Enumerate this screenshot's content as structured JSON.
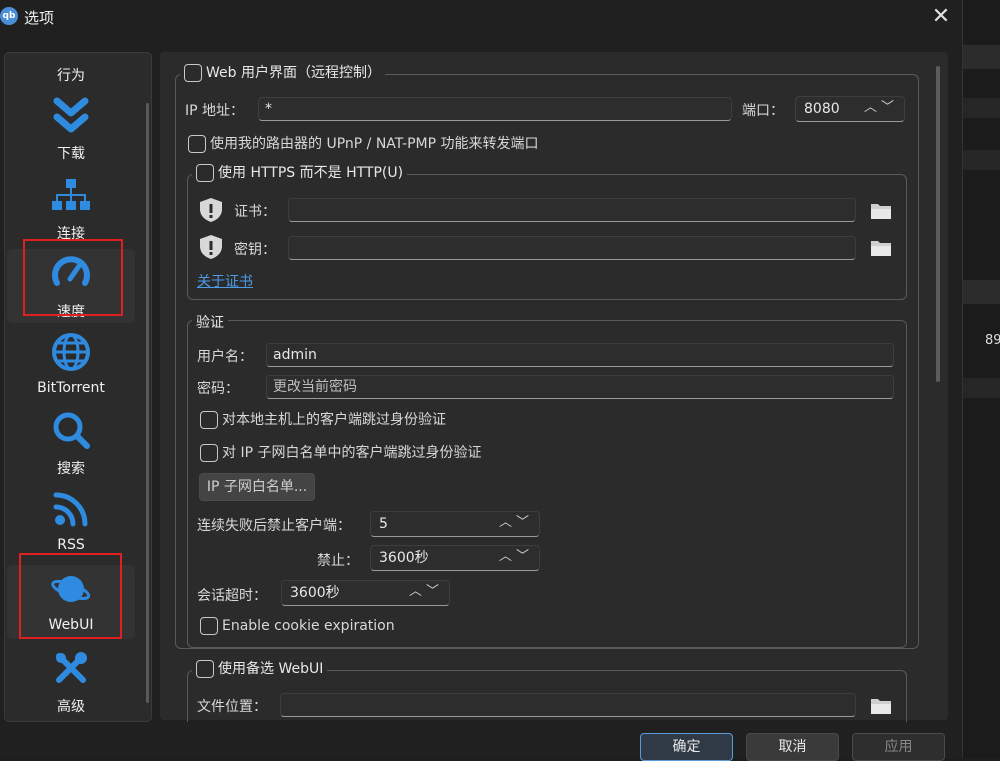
{
  "window": {
    "title": "选项",
    "app_icon_text": "qb"
  },
  "sidebar": {
    "items": [
      {
        "label": "行为",
        "icon": "behavior-icon"
      },
      {
        "label": "下载",
        "icon": "double-chevron-down-icon"
      },
      {
        "label": "连接",
        "icon": "network-icon"
      },
      {
        "label": "速度",
        "icon": "speedometer-icon"
      },
      {
        "label": "BitTorrent",
        "icon": "globe-icon"
      },
      {
        "label": "搜索",
        "icon": "search-icon"
      },
      {
        "label": "RSS",
        "icon": "rss-icon"
      },
      {
        "label": "WebUI",
        "icon": "planet-icon"
      },
      {
        "label": "高级",
        "icon": "tools-icon"
      }
    ],
    "selected": "WebUI"
  },
  "webui": {
    "group_label": "Web 用户界面（远程控制）",
    "ip_label": "IP 地址：",
    "ip_value": "*",
    "port_label": "端口：",
    "port_value": "8080",
    "upnp_label": "使用我的路由器的 UPnP / NAT-PMP 功能来转发端口",
    "https": {
      "group_label": "使用 HTTPS 而不是 HTTP(U)",
      "cert_label": "证书：",
      "cert_value": "",
      "key_label": "密钥：",
      "key_value": "",
      "about_link": "关于证书"
    },
    "auth": {
      "group_label": "验证",
      "username_label": "用户名：",
      "username_value": "admin",
      "password_label": "密码：",
      "password_placeholder": "更改当前密码",
      "bypass_local": "对本地主机上的客户端跳过身份验证",
      "bypass_whitelist": "对 IP 子网白名单中的客户端跳过身份验证",
      "whitelist_button": "IP 子网白名单...",
      "ban_after_label": "连续失败后禁止客户端：",
      "ban_after_value": "5",
      "ban_for_label": "禁止：",
      "ban_for_value": "3600秒",
      "session_timeout_label": "会话超时：",
      "session_timeout_value": "3600秒",
      "cookie_expiration": "Enable cookie expiration"
    },
    "alt_webui": {
      "group_label": "使用备选 WebUI",
      "location_label": "文件位置：",
      "location_value": ""
    }
  },
  "buttons": {
    "ok": "确定",
    "cancel": "取消",
    "apply": "应用"
  },
  "behind_window": {
    "partial_value": "89"
  },
  "colors": {
    "accent": "#2f8be0",
    "highlight_box": "#e02020",
    "link": "#4c9ce8"
  }
}
